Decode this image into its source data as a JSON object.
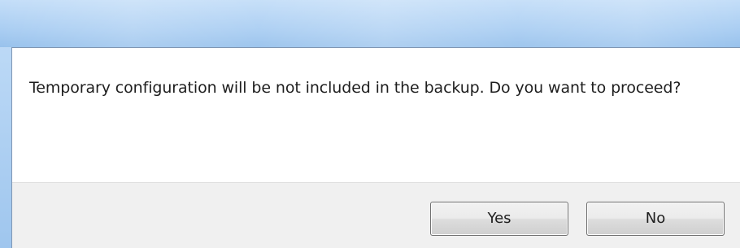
{
  "dialog": {
    "message": "Temporary configuration will be not included in the backup. Do you want to proceed?",
    "buttons": {
      "yes_label": "Yes",
      "no_label": "No"
    }
  },
  "colors": {
    "title_bar": "#a9cdf2",
    "client_background": "#ffffff",
    "button_panel_background": "#f0f0f0",
    "text": "#1e1e1e"
  }
}
